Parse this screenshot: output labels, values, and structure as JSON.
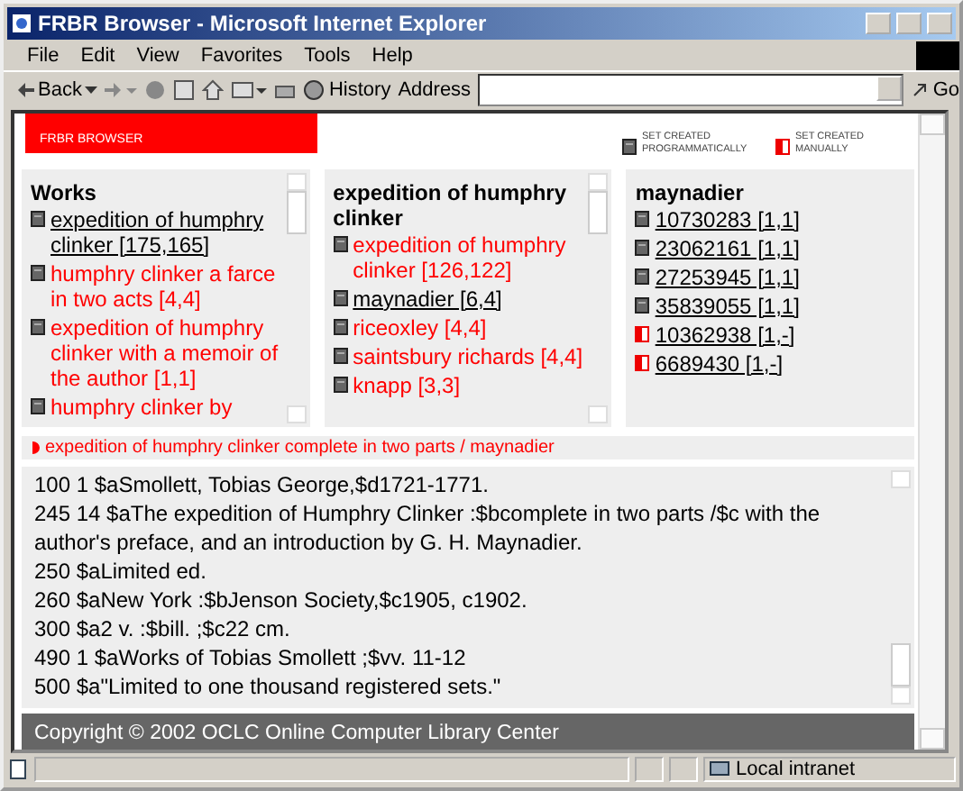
{
  "window": {
    "title": "FRBR Browser - Microsoft Internet Explorer"
  },
  "menu": [
    "File",
    "Edit",
    "View",
    "Favorites",
    "Tools",
    "Help"
  ],
  "toolbar": {
    "back": "Back",
    "history": "History",
    "address_label": "Address",
    "go": "Go"
  },
  "header": {
    "logo": "FRBR BROWSER",
    "legend": [
      {
        "kind": "programmatic",
        "label": "SET CREATED PROGRAMMATICALLY"
      },
      {
        "kind": "manual",
        "label": "SET CREATED MANUALLY"
      }
    ]
  },
  "panels": [
    {
      "title": "Works",
      "scrollbar": true,
      "items": [
        {
          "kind": "programmatic",
          "label": "expedition of humphry clinker [175,165]",
          "selected": true
        },
        {
          "kind": "programmatic",
          "label": "humphry clinker a farce in two acts [4,4]",
          "selected": false
        },
        {
          "kind": "programmatic",
          "label": "expedition of humphry clinker with a memoir of the author [1,1]",
          "selected": false
        },
        {
          "kind": "programmatic",
          "label": "humphry clinker by",
          "selected": false
        }
      ]
    },
    {
      "title": "expedition of humphry clinker",
      "scrollbar": true,
      "items": [
        {
          "kind": "programmatic",
          "label": "expedition of humphry clinker [126,122]",
          "selected": false
        },
        {
          "kind": "programmatic",
          "label": "maynadier [6,4]",
          "selected": true
        },
        {
          "kind": "programmatic",
          "label": "riceoxley [4,4]",
          "selected": false
        },
        {
          "kind": "programmatic",
          "label": "saintsbury richards [4,4]",
          "selected": false
        },
        {
          "kind": "programmatic",
          "label": "knapp [3,3]",
          "selected": false
        }
      ]
    },
    {
      "title": "maynadier",
      "scrollbar": false,
      "items": [
        {
          "kind": "programmatic",
          "label": "10730283 [1,1]",
          "selected": true
        },
        {
          "kind": "programmatic",
          "label": "23062161 [1,1]",
          "selected": true
        },
        {
          "kind": "programmatic",
          "label": "27253945 [1,1]",
          "selected": true
        },
        {
          "kind": "programmatic",
          "label": "35839055 [1,1]",
          "selected": true
        },
        {
          "kind": "manual",
          "label": "10362938 [1,-]",
          "selected": true
        },
        {
          "kind": "manual",
          "label": "6689430 [1,-]",
          "selected": true
        }
      ]
    }
  ],
  "breadcrumb": "expedition of humphry clinker complete in two parts / maynadier",
  "record": [
    "100 1 $aSmollett, Tobias George,$d1721-1771.",
    "245 14 $aThe expedition of Humphry Clinker :$bcomplete in two parts /$c with the author's preface, and an introduction by G. H. Maynadier.",
    "250 $aLimited ed.",
    "260 $aNew York :$bJenson Society,$c1905, c1902.",
    "300 $a2 v. :$bill. ;$c22 cm.",
    "490 1 $aWorks of Tobias Smollett ;$vv. 11-12",
    "500 $a\"Limited to one thousand registered sets.\""
  ],
  "footer": "Copyright © 2002 OCLC Online Computer Library Center",
  "status_bar": {
    "zone": "Local intranet"
  }
}
